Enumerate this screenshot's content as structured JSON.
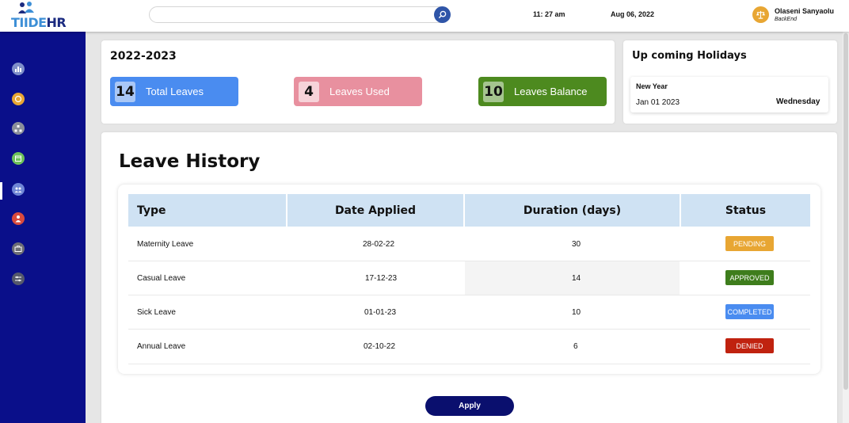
{
  "header": {
    "logo_part1": "TIIDE",
    "logo_part2": "HR",
    "search_placeholder": "",
    "time": "11: 27 am",
    "date": "Aug 06, 2022",
    "user_name": "Olaseni Sanyaolu",
    "user_role": "BackEnd"
  },
  "sidebar": {
    "items": [
      {
        "icon": "chart-icon",
        "color": "#7f8fc9"
      },
      {
        "icon": "coin-icon",
        "color": "#e8a633"
      },
      {
        "icon": "org-chart-icon",
        "color": "#8a8f9a"
      },
      {
        "icon": "leave-icon",
        "color": "#6ec25a"
      },
      {
        "icon": "team-icon",
        "color": "#6f86d6"
      },
      {
        "icon": "person-icon",
        "color": "#d94a3d"
      },
      {
        "icon": "briefcase-icon",
        "color": "#6d6e75"
      },
      {
        "icon": "settings-icon",
        "color": "#55596b"
      }
    ]
  },
  "summary": {
    "year": "2022-2023",
    "stats": [
      {
        "value": "14",
        "label": "Total Leaves",
        "color": "#4a8cf0"
      },
      {
        "value": "4",
        "label": "Leaves Used",
        "color": "#e8909f"
      },
      {
        "value": "10",
        "label": "Leaves Balance",
        "color": "#4d8a1f"
      }
    ]
  },
  "holidays": {
    "title": "Up coming Holidays",
    "name": "New Year",
    "date": "Jan 01 2023",
    "day": "Wednesday"
  },
  "history": {
    "title": "Leave History",
    "columns": [
      "Type",
      "Date Applied",
      "Duration (days)",
      "Status"
    ],
    "rows": [
      {
        "type": "Maternity Leave",
        "date": "28-02-22",
        "duration": "30",
        "status": "PENDING",
        "status_color": "#e8a633"
      },
      {
        "type": "Casual Leave",
        "date": "17-12-23",
        "duration": "14",
        "status": "APPROVED",
        "status_color": "#3e7d1c"
      },
      {
        "type": "Sick Leave",
        "date": "01-01-23",
        "duration": "10",
        "status": "COMPLETED",
        "status_color": "#4a8cf0"
      },
      {
        "type": "Annual Leave",
        "date": "02-10-22",
        "duration": "6",
        "status": "DENIED",
        "status_color": "#c0220f"
      }
    ]
  },
  "apply_label": "Apply"
}
